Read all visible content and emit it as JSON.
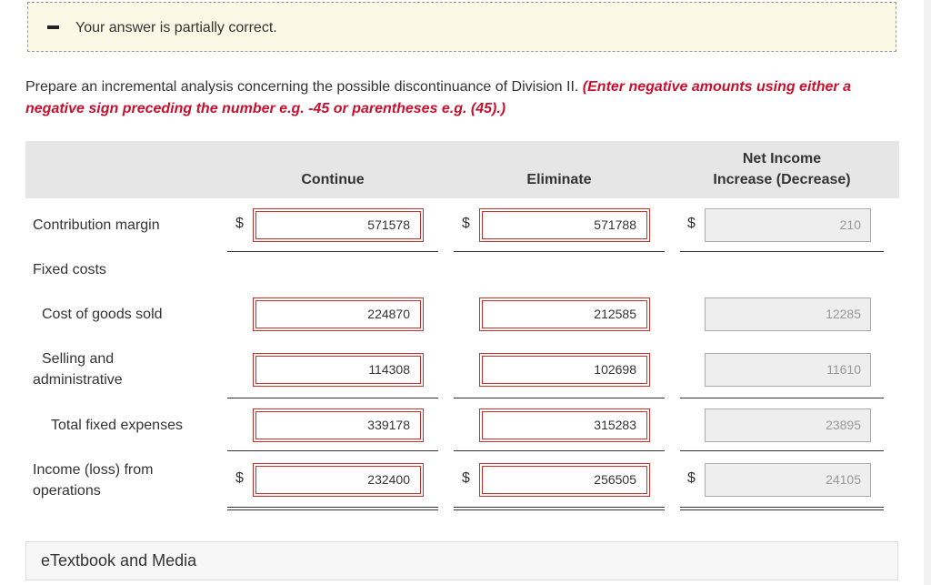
{
  "banner": {
    "message": "Your answer is partially correct."
  },
  "instructions": {
    "text": "Prepare an incremental analysis concerning the possible discontinuance of Division II.",
    "hint": "(Enter negative amounts using either a negative sign preceding the number e.g. -45 or parentheses e.g. (45).)"
  },
  "table": {
    "headers": {
      "continue": "Continue",
      "eliminate": "Eliminate",
      "net_income_line1": "Net Income",
      "net_income_line2": "Increase (Decrease)"
    },
    "currency": "$",
    "rows": [
      {
        "label": "Contribution margin",
        "continue": "571578",
        "eliminate": "571788",
        "net": "210"
      },
      {
        "label": "Fixed costs"
      },
      {
        "label": "Cost of goods sold",
        "continue": "224870",
        "eliminate": "212585",
        "net": "12285"
      },
      {
        "label_line1": "Selling and",
        "label_line2": "administrative",
        "continue": "114308",
        "eliminate": "102698",
        "net": "11610"
      },
      {
        "label": "Total fixed expenses",
        "continue": "339178",
        "eliminate": "315283",
        "net": "23895"
      },
      {
        "label_line1": "Income (loss) from",
        "label_line2": "operations",
        "continue": "232400",
        "eliminate": "256505",
        "net": "24105"
      }
    ]
  },
  "etextbook": {
    "label": "eTextbook and Media"
  }
}
